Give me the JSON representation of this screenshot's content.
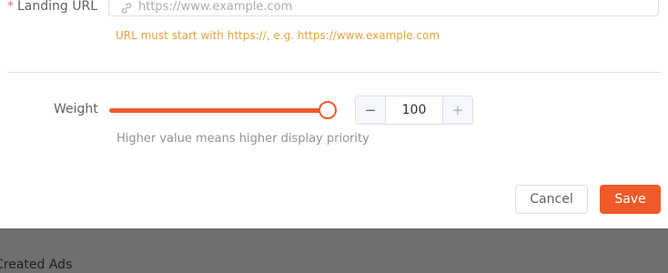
{
  "form": {
    "landing_url": {
      "required_mark": "*",
      "label": "Landing URL",
      "placeholder": "https://www.example.com",
      "value": "",
      "hint": "URL must start with https://, e.g. https://www.example.com",
      "icon": "link-icon"
    },
    "weight": {
      "label": "Weight",
      "value": "100",
      "slider_fraction": 1.0,
      "decrement_symbol": "−",
      "increment_symbol": "+",
      "hint": "Higher value means higher display priority"
    }
  },
  "footer": {
    "cancel_label": "Cancel",
    "save_label": "Save"
  },
  "background": {
    "section_title": "Created Ads"
  },
  "colors": {
    "accent": "#f05a28",
    "warning_hint": "#e6a23c",
    "required": "#f56c6c"
  }
}
